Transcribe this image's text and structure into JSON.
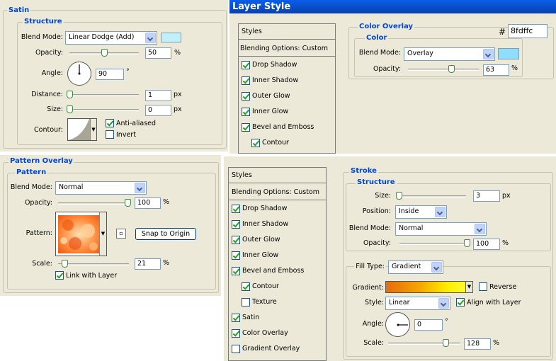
{
  "colors": {
    "overlay_color": "#8fdffc",
    "satin_color": "#c0f0f8",
    "accent": "#0046d5"
  },
  "satin": {
    "section_title": "Satin",
    "group_title": "Structure",
    "blend_mode_label": "Blend Mode:",
    "blend_mode_value": "Linear Dodge (Add)",
    "opacity_label": "Opacity:",
    "opacity_value": "50",
    "opacity_unit": "%",
    "opacity_fraction": 0.5,
    "angle_label": "Angle:",
    "angle_value": "90",
    "angle_unit": "°",
    "distance_label": "Distance:",
    "distance_value": "1",
    "distance_unit": "px",
    "size_label": "Size:",
    "size_value": "0",
    "size_unit": "px",
    "contour_label": "Contour:",
    "anti_aliased_label": "Anti-aliased",
    "anti_aliased_checked": true,
    "invert_label": "Invert",
    "invert_checked": false
  },
  "layer_style": {
    "window_title": "Layer Style",
    "styles_header": "Styles",
    "blending_options": "Blending Options: Custom",
    "items": [
      {
        "label": "Drop Shadow",
        "checked": true
      },
      {
        "label": "Inner Shadow",
        "checked": true
      },
      {
        "label": "Outer Glow",
        "checked": true
      },
      {
        "label": "Inner Glow",
        "checked": true
      },
      {
        "label": "Bevel and Emboss",
        "checked": true
      },
      {
        "label": "Contour",
        "checked": true
      }
    ],
    "color_overlay": {
      "section_title": "Color Overlay",
      "group_title": "Color",
      "hash": "#",
      "hex_value": "8fdffc",
      "blend_mode_label": "Blend Mode:",
      "blend_mode_value": "Overlay",
      "opacity_label": "Opacity:",
      "opacity_value": "63",
      "opacity_unit": "%",
      "opacity_fraction": 0.63
    }
  },
  "pattern_overlay": {
    "section_title": "Pattern Overlay",
    "group_title": "Pattern",
    "blend_mode_label": "Blend Mode:",
    "blend_mode_value": "Normal",
    "opacity_label": "Opacity:",
    "opacity_value": "100",
    "opacity_unit": "%",
    "opacity_fraction": 1.0,
    "pattern_label": "Pattern:",
    "snap_button": "Snap to Origin",
    "scale_label": "Scale:",
    "scale_value": "21",
    "scale_unit": "%",
    "link_label": "Link with Layer",
    "link_checked": true
  },
  "stroke_dialog": {
    "styles_header": "Styles",
    "blending_options": "Blending Options: Custom",
    "items": [
      {
        "label": "Drop Shadow",
        "checked": true
      },
      {
        "label": "Inner Shadow",
        "checked": true
      },
      {
        "label": "Outer Glow",
        "checked": true
      },
      {
        "label": "Inner Glow",
        "checked": true
      },
      {
        "label": "Bevel and Emboss",
        "checked": true
      },
      {
        "label": "Contour",
        "checked": true
      },
      {
        "label": "Texture",
        "checked": false
      },
      {
        "label": "Satin",
        "checked": true
      },
      {
        "label": "Color Overlay",
        "checked": true
      },
      {
        "label": "Gradient Overlay",
        "checked": false
      }
    ],
    "stroke": {
      "section_title": "Stroke",
      "group_title": "Structure",
      "size_label": "Size:",
      "size_value": "3",
      "size_unit": "px",
      "position_label": "Position:",
      "position_value": "Inside",
      "blend_mode_label": "Blend Mode:",
      "blend_mode_value": "Normal",
      "opacity_label": "Opacity:",
      "opacity_value": "100",
      "opacity_unit": "%",
      "opacity_fraction": 1.0,
      "fill_type_label": "Fill Type:",
      "fill_type_value": "Gradient",
      "gradient_label": "Gradient:",
      "reverse_label": "Reverse",
      "reverse_checked": false,
      "style_label": "Style:",
      "style_value": "Linear",
      "align_label": "Align with Layer",
      "align_checked": true,
      "angle_label": "Angle:",
      "angle_value": "0",
      "angle_unit": "°",
      "scale_label": "Scale:",
      "scale_value": "128",
      "scale_unit": "%"
    }
  }
}
